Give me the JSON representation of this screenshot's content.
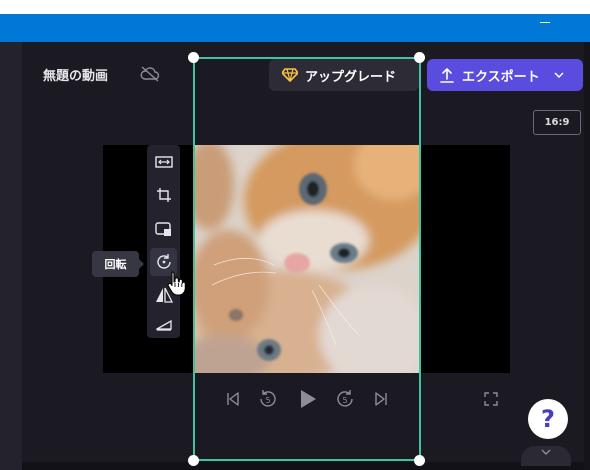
{
  "project": {
    "title": "無題の動画",
    "sync_icon": "cloud-off-icon"
  },
  "header": {
    "upgrade_label": "アップグレード",
    "upgrade_icon": "diamond-icon",
    "export_label": "エクスポート",
    "export_icon": "upload-icon"
  },
  "aspect_ratio": "16:9",
  "canvas_toolbar": {
    "items": [
      {
        "icon": "fit-icon"
      },
      {
        "icon": "crop-icon"
      },
      {
        "icon": "pip-icon"
      },
      {
        "icon": "rotate-icon"
      },
      {
        "icon": "flip-icon"
      },
      {
        "icon": "fade-icon"
      }
    ],
    "tooltip": "回転"
  },
  "playback": {
    "skip_back_seconds": "5",
    "skip_forward_seconds": "5",
    "controls": [
      "skip-to-start-icon",
      "rewind-5-icon",
      "play-icon",
      "forward-5-icon",
      "skip-to-end-icon",
      "fullscreen-icon"
    ]
  },
  "help_label": "?",
  "colors": {
    "accent": "#5b4ce0",
    "selection": "#3fc49f",
    "titlebar": "#0078d7",
    "upgrade_gem": "#f5c543"
  }
}
